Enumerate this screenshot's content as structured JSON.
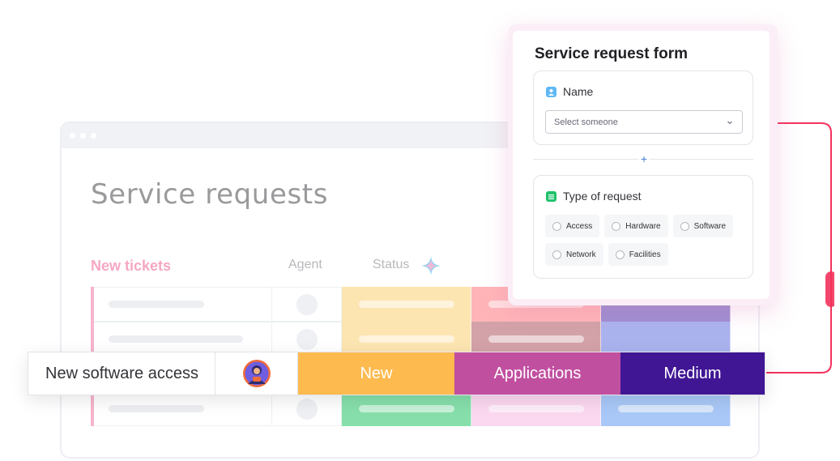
{
  "board": {
    "title": "Service requests",
    "group_title": "New tickets",
    "columns": {
      "agent": "Agent",
      "status": "Status"
    },
    "row_colors": [
      [
        "#fde5b2",
        "#ffb5b8",
        "#9d8ed1"
      ],
      [
        "#fde5b2",
        "#d3a2a8",
        "#aab3ee"
      ],
      [
        "#fde5b2",
        "#c58aa6",
        "#6753c2"
      ],
      [
        "#86dfab",
        "#fbd7f0",
        "#a9c8f7"
      ]
    ]
  },
  "ticket": {
    "name": "New software access",
    "status": "New",
    "category": "Applications",
    "priority": "Medium",
    "colors": {
      "status": "#fdba4f",
      "category": "#c14fa0",
      "priority": "#401694"
    }
  },
  "form": {
    "title": "Service request form",
    "name_section": {
      "label": "Name",
      "placeholder": "Select someone"
    },
    "add_symbol": "+",
    "type_section": {
      "label": "Type of request",
      "options": [
        "Access",
        "Hardware",
        "Software",
        "Network",
        "Facilities"
      ]
    }
  },
  "colors": {
    "accent_pink": "#f7b4cd",
    "connector": "#f2325c",
    "name_icon": "#5fb8f5",
    "type_icon": "#1fc26b"
  }
}
